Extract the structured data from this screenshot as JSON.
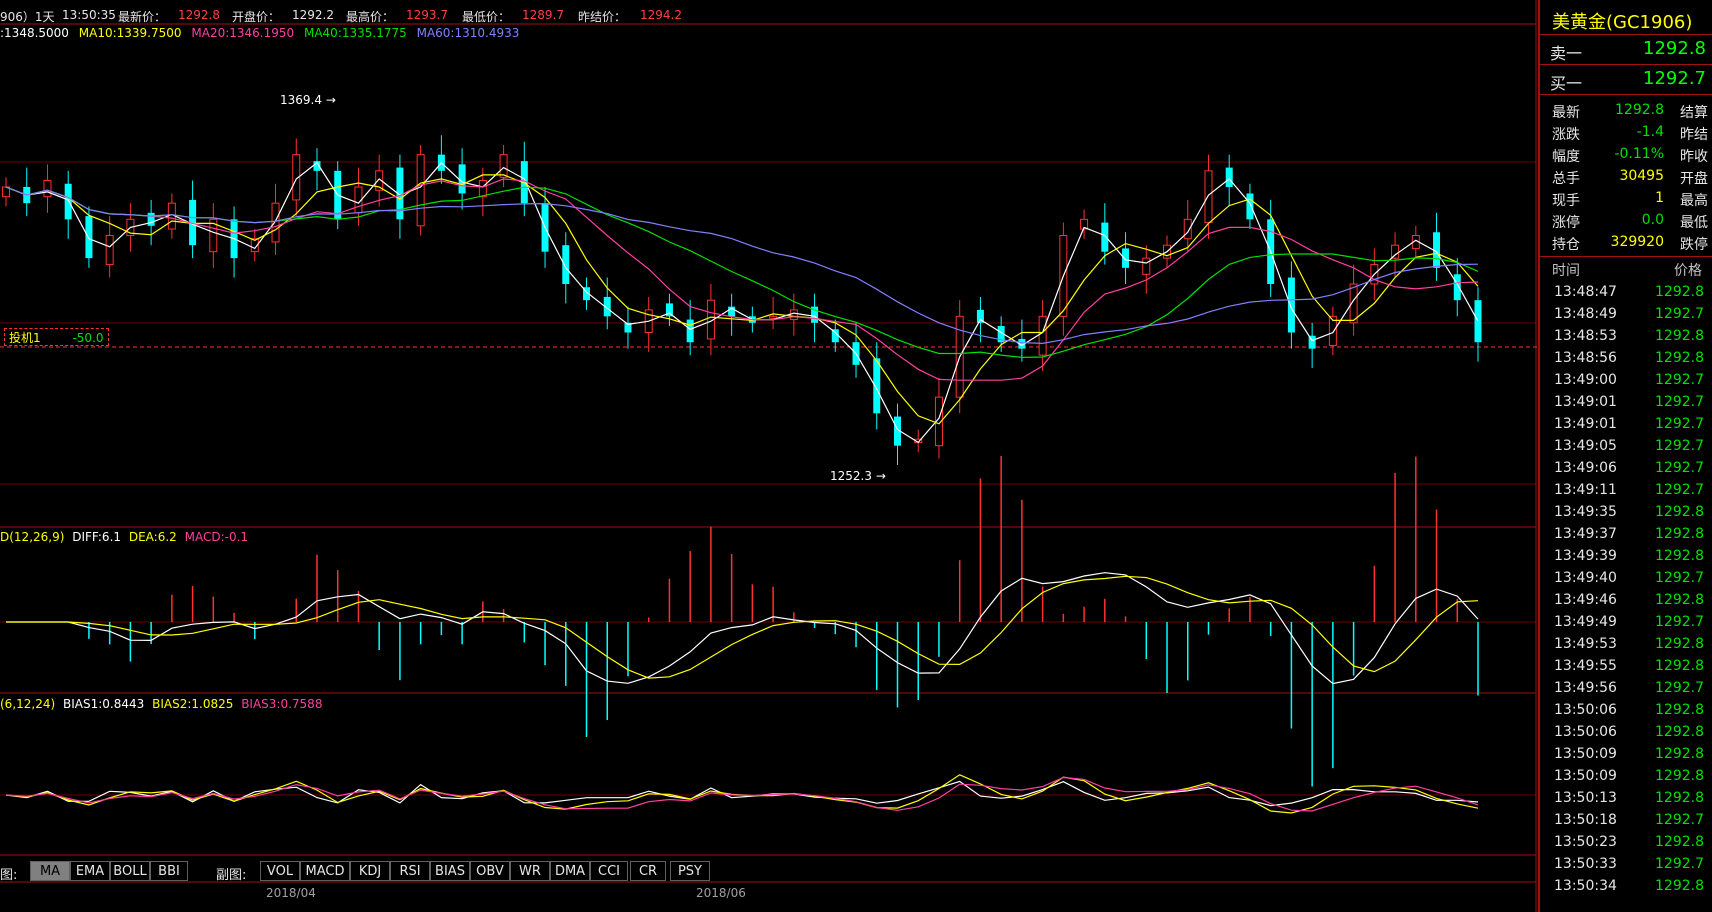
{
  "topbar": {
    "prefix": "906）1天",
    "time": "13:50:35",
    "latest_label": "最新价：",
    "latest": "1292.8",
    "open_label": "开盘价：",
    "open": "1292.2",
    "high_label": "最高价：",
    "high": "1293.7",
    "low_label": "最低价：",
    "low": "1289.7",
    "prevsettle_label": "昨结价：",
    "prevsettle": "1294.2"
  },
  "ma_legend": {
    "ma5": ":1348.5000",
    "ma10": "MA10:1339.7500",
    "ma20": "MA20:1346.1950",
    "ma40": "MA40:1335.1775",
    "ma60": "MA60:1310.4933"
  },
  "main_chart": {
    "high_marker": "1369.4",
    "low_marker": "1252.3",
    "order_label": "投机1",
    "order_value": "-50.0"
  },
  "macd": {
    "label": "D(12,26,9)",
    "diff": "DIFF:6.1",
    "dea": "DEA:6.2",
    "macd": "MACD:-0.1"
  },
  "bias": {
    "label": "(6,12,24)",
    "bias1": "BIAS1:0.8443",
    "bias2": "BIAS2:1.0825",
    "bias3": "BIAS3:0.7588"
  },
  "tabbar": {
    "main_label": "图:",
    "main_tabs": [
      "MA",
      "EMA",
      "BOLL",
      "BBI"
    ],
    "sub_label": "副图:",
    "sub_tabs": [
      "VOL",
      "MACD",
      "KDJ",
      "RSI",
      "BIAS",
      "OBV",
      "WR",
      "DMA",
      "CCI",
      "CR",
      "PSY"
    ]
  },
  "dates": [
    "2018/04",
    "2018/06"
  ],
  "panel": {
    "title": "美黄金(GC1906)",
    "sell_label": "卖一",
    "sell": "1292.8",
    "buy_label": "买一",
    "buy": "1292.7",
    "stats": [
      {
        "k": "最新",
        "v": "1292.8",
        "k2": "结算",
        "color": "#00e000"
      },
      {
        "k": "涨跌",
        "v": "-1.4",
        "k2": "昨结",
        "color": "#00e000"
      },
      {
        "k": "幅度",
        "v": "-0.11%",
        "k2": "昨收",
        "color": "#00e000"
      },
      {
        "k": "总手",
        "v": "30495",
        "k2": "开盘",
        "color": "#ffff00"
      },
      {
        "k": "现手",
        "v": "1",
        "k2": "最高",
        "color": "#ffff00"
      },
      {
        "k": "涨停",
        "v": "0.0",
        "k2": "最低",
        "color": "#00e000"
      },
      {
        "k": "持仓",
        "v": "329920",
        "k2": "跌停",
        "color": "#ffff00"
      }
    ],
    "ticks_header_time": "时间",
    "ticks_header_price": "价格",
    "ticks": [
      {
        "t": "13:48:47",
        "p": "1292.8"
      },
      {
        "t": "13:48:49",
        "p": "1292.7"
      },
      {
        "t": "13:48:53",
        "p": "1292.8"
      },
      {
        "t": "13:48:56",
        "p": "1292.8"
      },
      {
        "t": "13:49:00",
        "p": "1292.7"
      },
      {
        "t": "13:49:01",
        "p": "1292.7"
      },
      {
        "t": "13:49:01",
        "p": "1292.7"
      },
      {
        "t": "13:49:05",
        "p": "1292.7"
      },
      {
        "t": "13:49:06",
        "p": "1292.7"
      },
      {
        "t": "13:49:11",
        "p": "1292.7"
      },
      {
        "t": "13:49:35",
        "p": "1292.8"
      },
      {
        "t": "13:49:37",
        "p": "1292.8"
      },
      {
        "t": "13:49:39",
        "p": "1292.8"
      },
      {
        "t": "13:49:40",
        "p": "1292.7"
      },
      {
        "t": "13:49:46",
        "p": "1292.8"
      },
      {
        "t": "13:49:49",
        "p": "1292.7"
      },
      {
        "t": "13:49:53",
        "p": "1292.8"
      },
      {
        "t": "13:49:55",
        "p": "1292.8"
      },
      {
        "t": "13:49:56",
        "p": "1292.7"
      },
      {
        "t": "13:50:06",
        "p": "1292.8"
      },
      {
        "t": "13:50:06",
        "p": "1292.8"
      },
      {
        "t": "13:50:09",
        "p": "1292.8"
      },
      {
        "t": "13:50:09",
        "p": "1292.8"
      },
      {
        "t": "13:50:13",
        "p": "1292.8"
      },
      {
        "t": "13:50:18",
        "p": "1292.7"
      },
      {
        "t": "13:50:23",
        "p": "1292.8"
      },
      {
        "t": "13:50:33",
        "p": "1292.7"
      },
      {
        "t": "13:50:34",
        "p": "1292.8"
      }
    ]
  },
  "colors": {
    "up": "#ff3030",
    "down": "#00ffff",
    "ma5": "#ffffff",
    "ma10": "#ffff00",
    "ma20": "#ff3fa0",
    "ma40": "#00e000",
    "ma60": "#8080ff",
    "grid": "#8b0000"
  },
  "chart_data": {
    "type": "candlestick",
    "highest": 1369.4,
    "lowest": 1252.3,
    "close_series_approx": [
      1340,
      1335,
      1342,
      1330,
      1318,
      1325,
      1330,
      1328,
      1335,
      1322,
      1330,
      1318,
      1324,
      1335,
      1350,
      1345,
      1330,
      1340,
      1345,
      1330,
      1350,
      1345,
      1338,
      1342,
      1350,
      1335,
      1320,
      1310,
      1305,
      1300,
      1295,
      1302,
      1300,
      1292,
      1305,
      1300,
      1298,
      1300,
      1302,
      1298,
      1292,
      1285,
      1270,
      1260,
      1262,
      1275,
      1300,
      1298,
      1292,
      1290,
      1300,
      1325,
      1330,
      1320,
      1315,
      1318,
      1322,
      1330,
      1345,
      1340,
      1330,
      1310,
      1295,
      1290,
      1300,
      1310,
      1316,
      1322,
      1325,
      1315,
      1305,
      1292
    ]
  }
}
